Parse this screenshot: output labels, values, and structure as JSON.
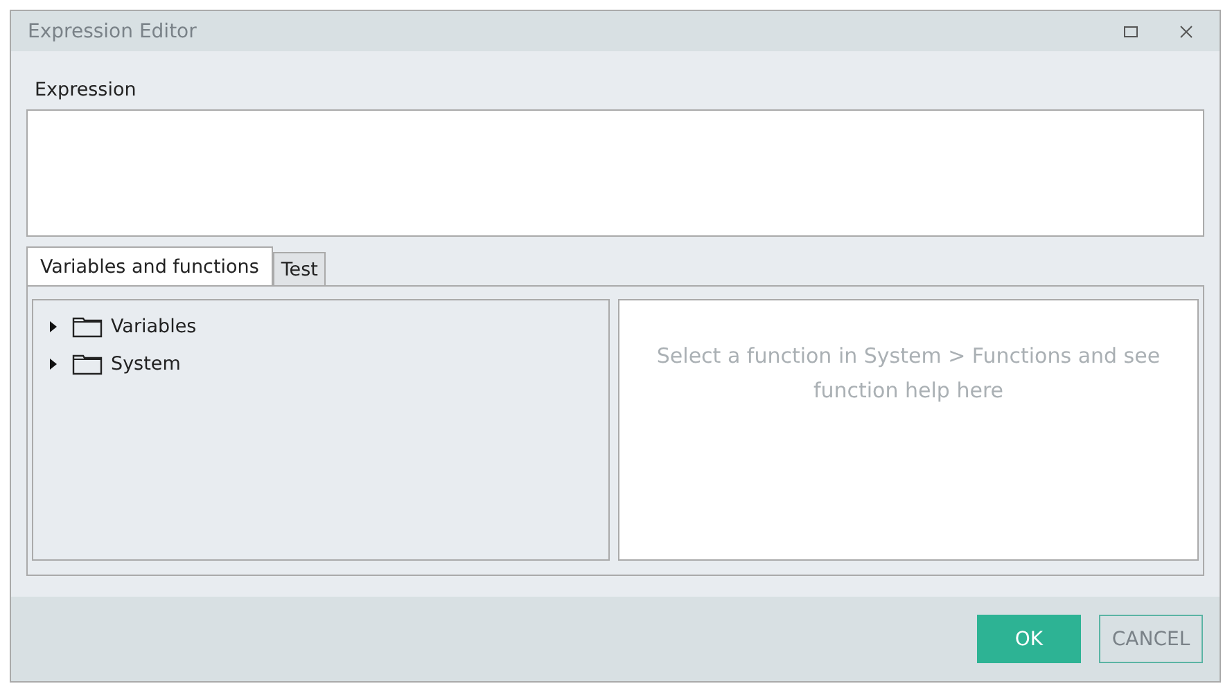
{
  "window": {
    "title": "Expression Editor"
  },
  "expression": {
    "label": "Expression"
  },
  "tabs": [
    {
      "label": "Variables and functions",
      "selected": true
    },
    {
      "label": "Test",
      "selected": false
    }
  ],
  "tree": [
    {
      "label": "Variables",
      "expanded": false
    },
    {
      "label": "System",
      "expanded": false
    }
  ],
  "help_text": "Select a function in System > Functions and see function help here",
  "buttons": [
    {
      "label": "OK",
      "kind": "primary"
    },
    {
      "label": "CANCEL",
      "kind": "secondary"
    }
  ]
}
